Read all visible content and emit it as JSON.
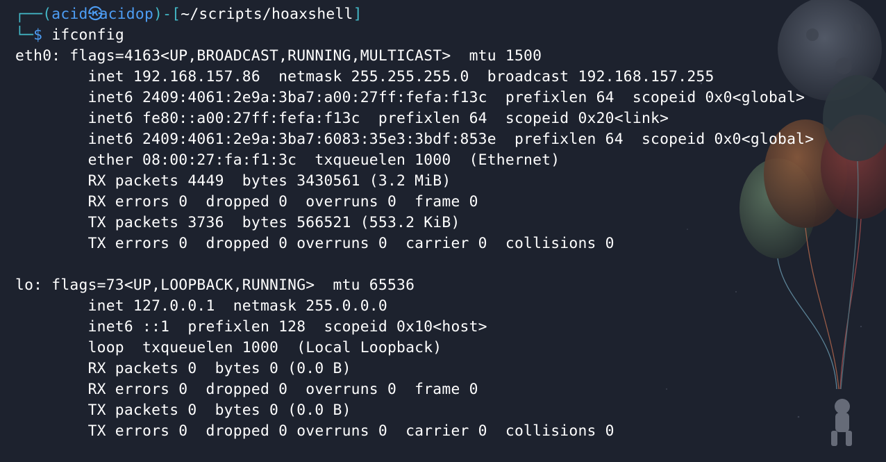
{
  "prompt": {
    "frame_open": "┌──(",
    "user": "acid",
    "host": "acidop",
    "frame_mid": ")-[",
    "cwd": "~/scripts/hoaxshell",
    "frame_close": "]",
    "frame_bottom": "└─",
    "dollar": "$",
    "command": "ifconfig",
    "skull_icon": "skull-icon"
  },
  "output": {
    "eth0": [
      "eth0: flags=4163<UP,BROADCAST,RUNNING,MULTICAST>  mtu 1500",
      "        inet 192.168.157.86  netmask 255.255.255.0  broadcast 192.168.157.255",
      "        inet6 2409:4061:2e9a:3ba7:a00:27ff:fefa:f13c  prefixlen 64  scopeid 0x0<global>",
      "        inet6 fe80::a00:27ff:fefa:f13c  prefixlen 64  scopeid 0x20<link>",
      "        inet6 2409:4061:2e9a:3ba7:6083:35e3:3bdf:853e  prefixlen 64  scopeid 0x0<global>",
      "        ether 08:00:27:fa:f1:3c  txqueuelen 1000  (Ethernet)",
      "        RX packets 4449  bytes 3430561 (3.2 MiB)",
      "        RX errors 0  dropped 0  overruns 0  frame 0",
      "        TX packets 3736  bytes 566521 (553.2 KiB)",
      "        TX errors 0  dropped 0 overruns 0  carrier 0  collisions 0"
    ],
    "lo": [
      "lo: flags=73<UP,LOOPBACK,RUNNING>  mtu 65536",
      "        inet 127.0.0.1  netmask 255.0.0.0",
      "        inet6 ::1  prefixlen 128  scopeid 0x10<host>",
      "        loop  txqueuelen 1000  (Local Loopback)",
      "        RX packets 0  bytes 0 (0.0 B)",
      "        RX errors 0  dropped 0  overruns 0  frame 0",
      "        TX packets 0  bytes 0 (0.0 B)",
      "        TX errors 0  dropped 0 overruns 0  carrier 0  collisions 0"
    ]
  },
  "colors": {
    "background": "#1d222e",
    "prompt_frame": "#43b8c7",
    "prompt_user": "#4d9df4",
    "text": "#ffffff"
  }
}
